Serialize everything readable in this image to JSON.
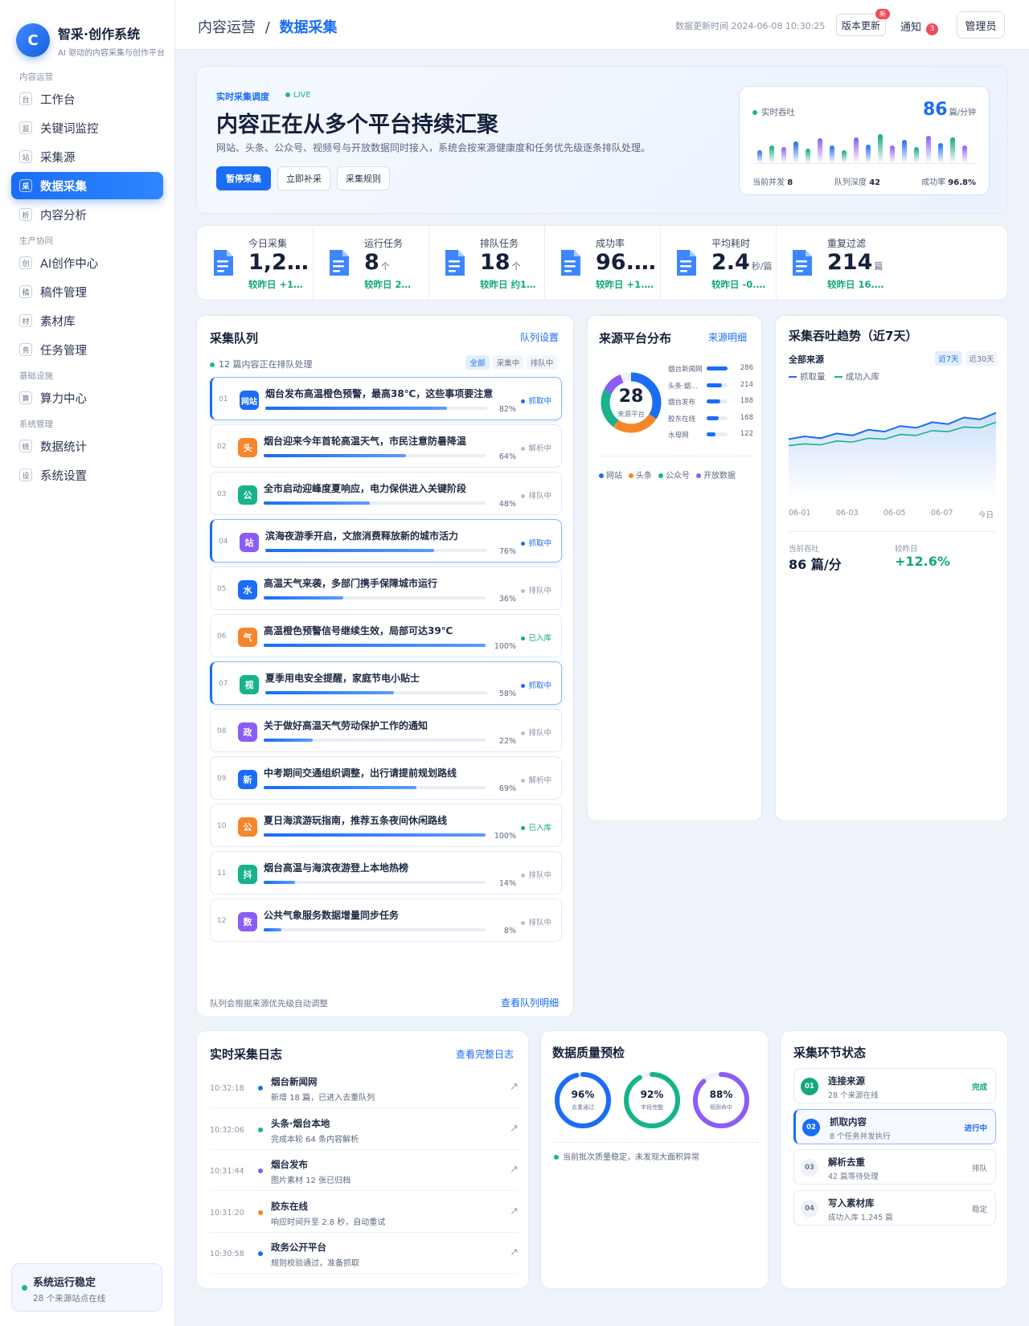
{
  "brand": {
    "logo": "C",
    "name": "智采·创作系统",
    "subtitle": "AI 驱动的内容采集与创作平台"
  },
  "nav": [
    {
      "group": "内容运营",
      "items": [
        {
          "icon": "台",
          "label": "工作台"
        },
        {
          "icon": "监",
          "label": "关键词监控"
        },
        {
          "icon": "站",
          "label": "采集源"
        },
        {
          "icon": "采",
          "label": "数据采集",
          "active": true
        },
        {
          "icon": "析",
          "label": "内容分析"
        }
      ]
    },
    {
      "group": "生产协同",
      "items": [
        {
          "icon": "创",
          "label": "AI创作中心"
        },
        {
          "icon": "稿",
          "label": "稿件管理"
        },
        {
          "icon": "材",
          "label": "素材库"
        },
        {
          "icon": "务",
          "label": "任务管理"
        }
      ]
    },
    {
      "group": "基础设施",
      "items": [
        {
          "icon": "算",
          "label": "算力中心"
        }
      ]
    },
    {
      "group": "系统管理",
      "items": [
        {
          "icon": "统",
          "label": "数据统计"
        },
        {
          "icon": "设",
          "label": "系统设置"
        }
      ]
    }
  ],
  "sys_status": {
    "title": "系统运行稳定",
    "sub": "28 个来源站点在线"
  },
  "topbar": {
    "crumb_parent": "内容运营",
    "crumb_sep": "/",
    "crumb_current": "数据采集",
    "update_text": "数据更新时间 2024-06-08 10:30:25",
    "version_btn": "版本更新",
    "version_badge": "新",
    "notice": "通知",
    "notice_count": "3",
    "admin": "管理员"
  },
  "hero": {
    "tag": "实时采集调度",
    "live": "LIVE",
    "title": "内容正在从多个平台持续汇聚",
    "desc": "网站、头条、公众号、视频号与开放数据同时接入，系统会按来源健康度和任务优先级逐条排队处理。",
    "buttons": [
      "暂停采集",
      "立即补采",
      "采集规则"
    ],
    "live_box": {
      "label": "实时吞吐",
      "value": "86",
      "unit": "篇/分钟",
      "bars": [
        0.45,
        0.62,
        0.55,
        0.75,
        0.5,
        0.85,
        0.6,
        0.45,
        0.9,
        0.65,
        1.0,
        0.6,
        0.8,
        0.55,
        0.95,
        0.7,
        0.88,
        0.6
      ],
      "bar_colors": [
        "#1a6df5",
        "#13a97c",
        "#8b5cf6"
      ],
      "concurrency_label": "当前并发",
      "concurrency": "8",
      "depth_label": "队列深度",
      "depth": "42",
      "success_label": "成功率",
      "success": "96.8%"
    }
  },
  "stats": [
    {
      "label": "今日采集",
      "value": "1,2…",
      "unit": "",
      "change": "较昨日 +1…",
      "icon": "doc-icon"
    },
    {
      "label": "运行任务",
      "value": "8",
      "unit": "个",
      "change": "较昨日 2…",
      "icon": "search-doc-icon"
    },
    {
      "label": "排队任务",
      "value": "18",
      "unit": "个",
      "change": "较昨日 约1…",
      "icon": "queue-icon"
    },
    {
      "label": "成功率",
      "value": "96.…",
      "unit": "",
      "change": "较昨日 +1.…",
      "icon": "shield-icon"
    },
    {
      "label": "平均耗时",
      "value": "2.4",
      "unit": "秒/篇",
      "change": "较昨日 -0.…",
      "icon": "add-doc-icon"
    },
    {
      "label": "重复过滤",
      "value": "214",
      "unit": "篇",
      "change": "较昨日 16.…",
      "icon": "clipboard-icon"
    }
  ],
  "queue": {
    "title": "采集队列",
    "link": "队列设置",
    "sub": "12 篇内容正在排队处理",
    "filters": [
      "全部",
      "采集中",
      "排队中"
    ],
    "foot": "队列会根据来源优先级自动调整",
    "foot_link": "查看队列明细",
    "items": [
      {
        "no": "01",
        "icon": "网站",
        "color": "#1a6df5",
        "title": "烟台发布高温橙色预警，最高38℃，这些事项要注意",
        "pct": 82,
        "pct_text": "82%",
        "status": "抓取中",
        "kind": "grab",
        "active": true
      },
      {
        "no": "02",
        "icon": "头",
        "color": "#f7852a",
        "title": "烟台迎来今年首轮高温天气，市民注意防暑降温",
        "pct": 64,
        "pct_text": "64%",
        "status": "解析中",
        "kind": "parse"
      },
      {
        "no": "03",
        "icon": "公",
        "color": "#17b38a",
        "title": "全市启动迎峰度夏响应，电力保供进入关键阶段",
        "pct": 48,
        "pct_text": "48%",
        "status": "排队中",
        "kind": "queue"
      },
      {
        "no": "04",
        "icon": "站",
        "color": "#8b5cf6",
        "title": "滨海夜游季开启，文旅消费释放新的城市活力",
        "pct": 76,
        "pct_text": "76%",
        "status": "抓取中",
        "kind": "grab",
        "active": true
      },
      {
        "no": "05",
        "icon": "水",
        "color": "#1a6df5",
        "title": "高温天气来袭，多部门携手保障城市运行",
        "pct": 36,
        "pct_text": "36%",
        "status": "排队中",
        "kind": "queue"
      },
      {
        "no": "06",
        "icon": "气",
        "color": "#f7852a",
        "title": "高温橙色预警信号继续生效，局部可达39℃",
        "pct": 100,
        "pct_text": "100%",
        "status": "已入库",
        "kind": "done"
      },
      {
        "no": "07",
        "icon": "视",
        "color": "#17b38a",
        "title": "夏季用电安全提醒，家庭节电小贴士",
        "pct": 58,
        "pct_text": "58%",
        "status": "抓取中",
        "kind": "grab",
        "active": true
      },
      {
        "no": "08",
        "icon": "政",
        "color": "#8b5cf6",
        "title": "关于做好高温天气劳动保护工作的通知",
        "pct": 22,
        "pct_text": "22%",
        "status": "排队中",
        "kind": "queue"
      },
      {
        "no": "09",
        "icon": "新",
        "color": "#1a6df5",
        "title": "中考期间交通组织调整，出行请提前规划路线",
        "pct": 69,
        "pct_text": "69%",
        "status": "解析中",
        "kind": "parse"
      },
      {
        "no": "10",
        "icon": "公",
        "color": "#f7852a",
        "title": "夏日海滨游玩指南，推荐五条夜间休闲路线",
        "pct": 100,
        "pct_text": "100%",
        "status": "已入库",
        "kind": "done"
      },
      {
        "no": "11",
        "icon": "抖",
        "color": "#17b38a",
        "title": "烟台高温与海滨夜游登上本地热榜",
        "pct": 14,
        "pct_text": "14%",
        "status": "排队中",
        "kind": "queue"
      },
      {
        "no": "12",
        "icon": "数",
        "color": "#8b5cf6",
        "title": "公共气象服务数据增量同步任务",
        "pct": 8,
        "pct_text": "8%",
        "status": "排队中",
        "kind": "queue"
      }
    ]
  },
  "source": {
    "title": "来源平台分布",
    "link": "来源明细",
    "total": "28",
    "total_label": "来源平台",
    "donut": [
      {
        "share": 0.34,
        "color": "#1a6df5"
      },
      {
        "share": 0.26,
        "color": "#f7852a"
      },
      {
        "share": 0.22,
        "color": "#17b38a"
      },
      {
        "share": 0.12,
        "color": "#8b5cf6"
      }
    ],
    "rows": [
      {
        "name": "烟台新闻网",
        "value": 286,
        "text": "286"
      },
      {
        "name": "头条·烟…",
        "value": 214,
        "text": "214"
      },
      {
        "name": "烟台发布",
        "value": 188,
        "text": "188"
      },
      {
        "name": "胶东在线",
        "value": 168,
        "text": "168"
      },
      {
        "name": "水母网",
        "value": 122,
        "text": "122"
      }
    ],
    "legend": [
      {
        "name": "网站",
        "color": "#1a6df5"
      },
      {
        "name": "头条",
        "color": "#f7852a"
      },
      {
        "name": "公众号",
        "color": "#17b38a"
      },
      {
        "name": "开放数据",
        "color": "#8b5cf6"
      }
    ]
  },
  "trend": {
    "title": "采集吞吐趋势（近7天）",
    "scope": "全部来源",
    "tabs": [
      "近7天",
      "近30天"
    ],
    "series_names": [
      "抓取量",
      "成功入库"
    ],
    "series_colors": [
      "#1a6df5",
      "#17b38a"
    ],
    "x": [
      "06-01",
      "06-03",
      "06-05",
      "06-07",
      "今日"
    ],
    "chart_data": {
      "type": "line",
      "series": [
        {
          "name": "抓取量",
          "values": [
            62,
            65,
            63,
            68,
            66,
            72,
            70,
            76,
            74,
            80,
            78,
            85,
            83,
            90
          ]
        },
        {
          "name": "成功入库",
          "values": [
            55,
            57,
            56,
            60,
            59,
            63,
            62,
            67,
            66,
            71,
            70,
            75,
            74,
            80
          ]
        }
      ],
      "ylim": [
        0,
        100
      ]
    },
    "f1_label": "当前吞吐",
    "f1_value": "86 篇/分",
    "f2_label": "较昨日",
    "f2_value": "+12.6%"
  },
  "logs": {
    "title": "实时采集日志",
    "link": "查看完整日志",
    "items": [
      {
        "time": "10:32:18",
        "color": "#1a6df5",
        "source": "烟台新闻网",
        "msg": "新增 18 篇，已进入去重队列"
      },
      {
        "time": "10:32:06",
        "color": "#17b38a",
        "source": "头条·烟台本地",
        "msg": "完成本轮 64 条内容解析"
      },
      {
        "time": "10:31:44",
        "color": "#8b5cf6",
        "source": "烟台发布",
        "msg": "图片素材 12 张已归档"
      },
      {
        "time": "10:31:20",
        "color": "#f7852a",
        "source": "胶东在线",
        "msg": "响应时间升至 2.8 秒，自动重试"
      },
      {
        "time": "10:30:58",
        "color": "#1a6df5",
        "source": "政务公开平台",
        "msg": "规则校验通过，准备抓取"
      }
    ]
  },
  "quality": {
    "title": "数据质量预检",
    "rings": [
      {
        "value": 96,
        "text": "96%",
        "label": "去重通过",
        "color": "#1a6df5"
      },
      {
        "value": 92,
        "text": "92%",
        "label": "字段完整",
        "color": "#17b38a"
      },
      {
        "value": 88,
        "text": "88%",
        "label": "规则命中",
        "color": "#8b5cf6"
      }
    ],
    "note": "当前批次质量稳定，未发现大面积异常"
  },
  "stages": {
    "title": "采集环节状态",
    "items": [
      {
        "no": "01",
        "title": "连接来源",
        "sub": "28 个来源在线",
        "status": "完成",
        "kind": "done"
      },
      {
        "no": "02",
        "title": "抓取内容",
        "sub": "8 个任务并发执行",
        "status": "进行中",
        "kind": "run"
      },
      {
        "no": "03",
        "title": "解析去重",
        "sub": "42 篇等待处理",
        "status": "排队",
        "kind": "wait"
      },
      {
        "no": "04",
        "title": "写入素材库",
        "sub": "成功入库 1,245 篇",
        "status": "稳定",
        "kind": "stable"
      }
    ]
  }
}
